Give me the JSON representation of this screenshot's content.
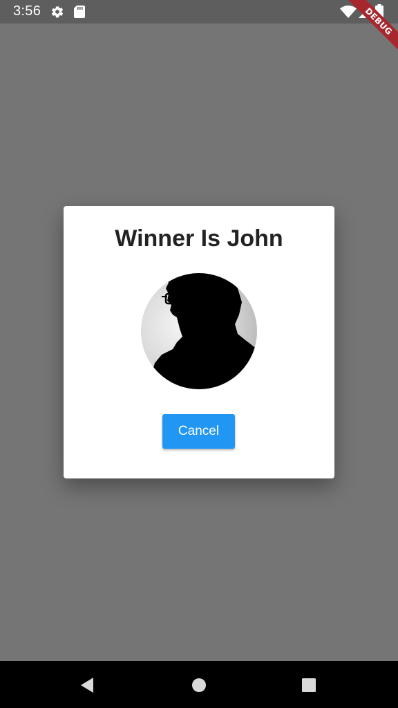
{
  "status_bar": {
    "time": "3:56",
    "icons": [
      "settings-icon",
      "sd-card-icon",
      "wifi-icon",
      "signal-icon",
      "battery-icon"
    ]
  },
  "debug_banner": {
    "label": "DEBUG",
    "color": "#a8262d"
  },
  "dialog": {
    "title": "Winner Is John",
    "avatar": "silhouette-portrait",
    "cancel_label": "Cancel",
    "button_color": "#2196f3"
  },
  "nav_bar": {
    "buttons": [
      "back-icon",
      "home-icon",
      "recents-icon"
    ]
  },
  "colors": {
    "scrim": "#757575",
    "status_bar": "#5e5e5e",
    "nav_bar": "#000000"
  }
}
